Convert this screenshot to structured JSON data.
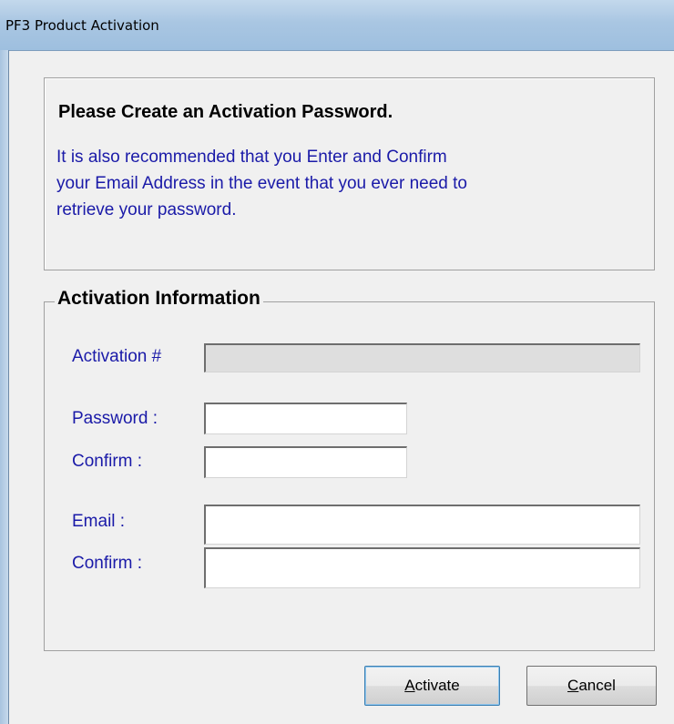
{
  "window": {
    "title": "PF3 Product Activation"
  },
  "info": {
    "heading": "Please Create an Activation Password.",
    "line1": "It is also recommended that you Enter and Confirm",
    "line2": "your Email Address in the event that you ever need to",
    "line3": "retrieve your password."
  },
  "group": {
    "legend": "Activation Information",
    "activation_label": "Activation #",
    "activation_value": "",
    "password_label": "Password :",
    "password_value": "",
    "password_confirm_label": "Confirm :",
    "password_confirm_value": "",
    "email_label": "Email :",
    "email_value": "",
    "email_confirm_label": "Confirm :",
    "email_confirm_value": ""
  },
  "buttons": {
    "activate_mnemonic": "A",
    "activate_rest": "ctivate",
    "cancel_mnemonic": "C",
    "cancel_rest": "ancel"
  }
}
